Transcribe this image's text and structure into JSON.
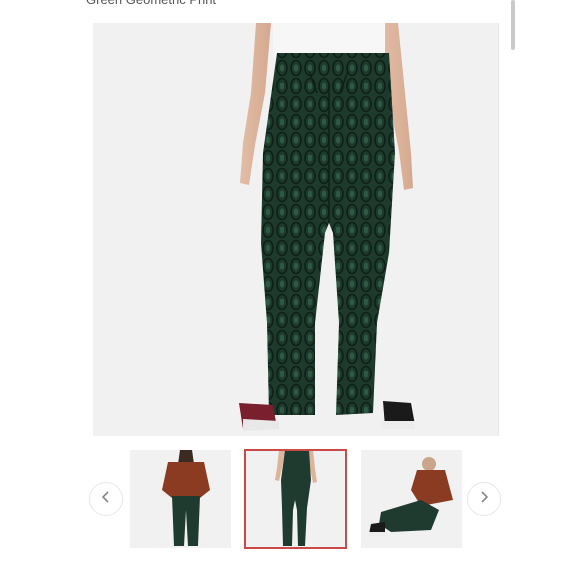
{
  "product": {
    "title": "Green Geometric Print"
  },
  "gallery": {
    "zoom_icon": "magnifier-icon",
    "prev_icon": "chevron-left-icon",
    "next_icon": "chevron-right-icon",
    "thumbnail_count": 3,
    "selected_thumbnail": 2,
    "colors": {
      "selected_border": "#c94a48",
      "pants_green": "#1f3a2e",
      "jacket_brown": "#8a3b22",
      "background": "#f1f1f1"
    }
  }
}
